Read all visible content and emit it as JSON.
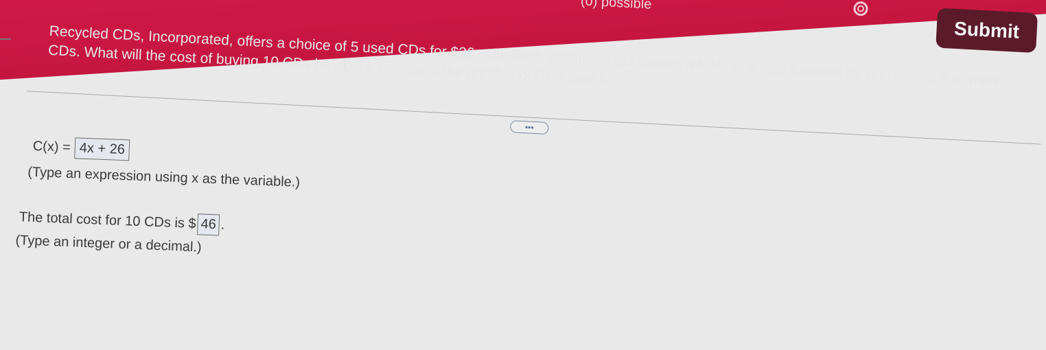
{
  "header": {
    "partial_text": "(0) possible",
    "submit_label": "Submit",
    "settings_icon": "gear-icon"
  },
  "question": {
    "text": "Recycled CDs, Incorporated, offers a choice of 5 used CDs for $26, with each additional CD costing $4. Write a cost function for purchasing 5 or more CDs. What will the cost of buying 10 CDs be? Let x represent the number of CDs over 5.",
    "more_label": "•••"
  },
  "answers": {
    "function_label": "C(x) =",
    "function_value": "4x + 26",
    "function_hint": "(Type an expression using x as the variable.)",
    "cost_label": "The total cost for 10 CDs is $",
    "cost_value": "46",
    "cost_suffix": ".",
    "cost_hint": "(Type an integer or a decimal.)"
  },
  "colors": {
    "banner": "#c5163f",
    "submit_bg": "#5b1a2a",
    "background": "#e9e9e9"
  }
}
